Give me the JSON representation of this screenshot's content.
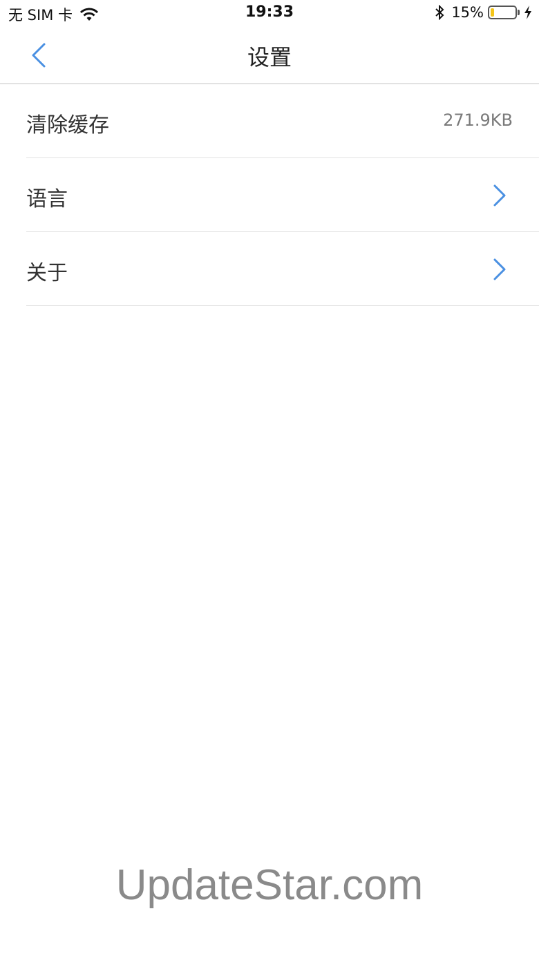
{
  "status_bar": {
    "carrier": "无 SIM 卡",
    "time": "19:33",
    "battery_percent_text": "15%",
    "battery_level": 0.15,
    "battery_color": "#f4c518",
    "icons": [
      "wifi-icon",
      "bluetooth-icon",
      "battery-icon",
      "charging-bolt-icon"
    ]
  },
  "nav": {
    "title": "设置",
    "back_icon": "chevron-left-icon",
    "accent_color": "#4a90e2"
  },
  "settings": {
    "items": [
      {
        "label": "清除缓存",
        "value": "271.9KB"
      },
      {
        "label": "语言",
        "icon": "chevron-right-icon"
      },
      {
        "label": "关于",
        "icon": "chevron-right-icon"
      }
    ]
  },
  "watermark": "UpdateStar.com"
}
